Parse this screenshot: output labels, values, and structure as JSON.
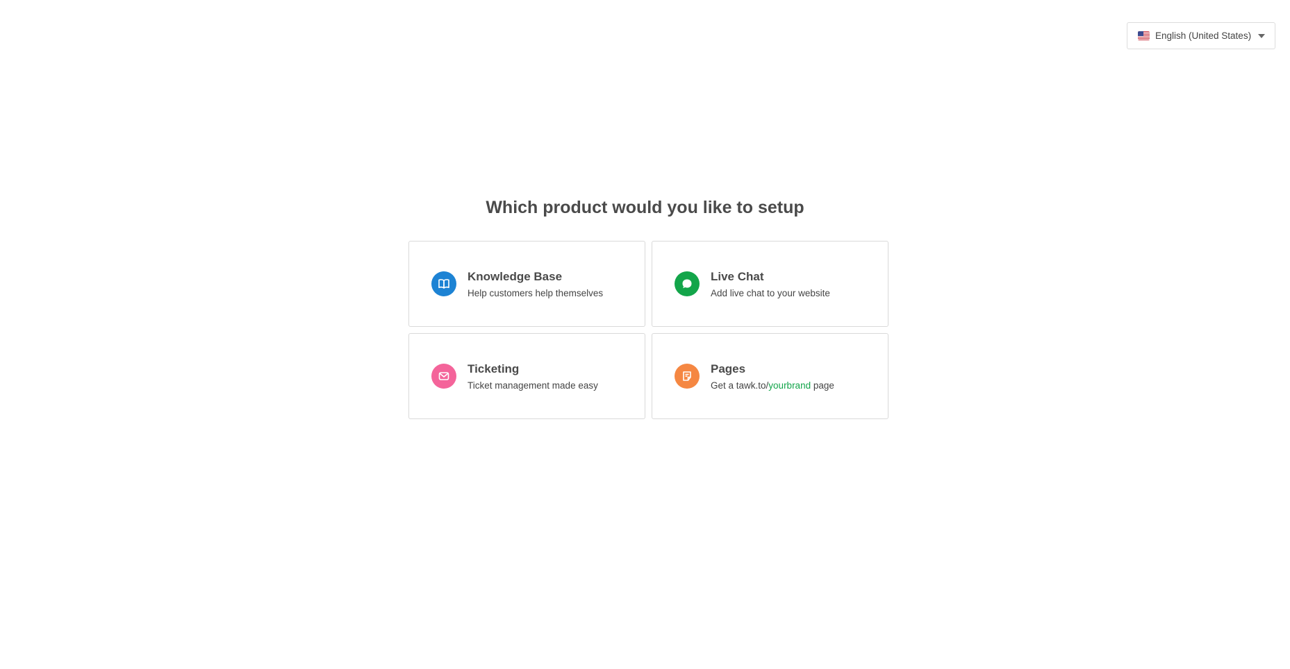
{
  "language_selector": {
    "label": "English (United States)",
    "flag_icon": "us-flag-icon",
    "caret_icon": "chevron-down-icon"
  },
  "page": {
    "title": "Which product would you like to setup"
  },
  "products": [
    {
      "title": "Knowledge Base",
      "description": "Help customers help themselves",
      "icon": "book-icon",
      "color": "#1d83d4"
    },
    {
      "title": "Live Chat",
      "description": "Add live chat to your website",
      "icon": "chat-bubble-icon",
      "color": "#13a54a"
    },
    {
      "title": "Ticketing",
      "description": "Ticket management made easy",
      "icon": "envelope-icon",
      "color": "#f4649a"
    },
    {
      "title": "Pages",
      "description_prefix": "Get a tawk.to/",
      "description_highlight": "yourbrand",
      "description_suffix": " page",
      "icon": "page-icon",
      "color": "#f58742"
    }
  ],
  "colors": {
    "accent_green": "#13a54a"
  }
}
